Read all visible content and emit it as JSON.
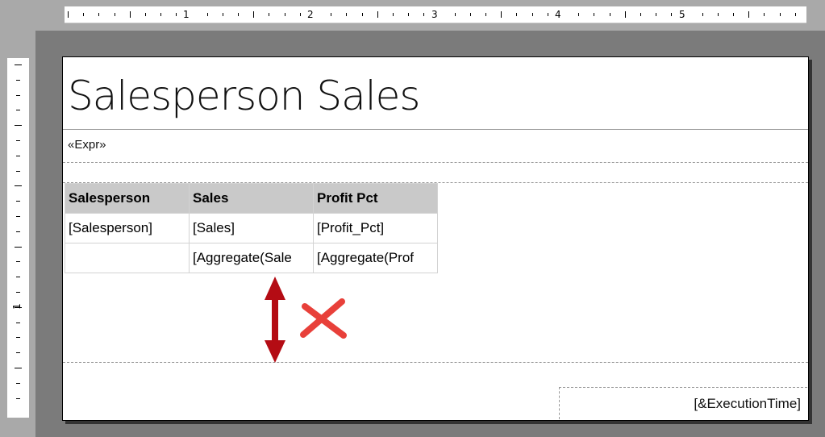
{
  "report": {
    "title": "Salesperson Sales",
    "subtitle_expr": "«Expr»",
    "table": {
      "headers": [
        "Salesperson",
        "Sales",
        "Profit Pct"
      ],
      "detail_row": [
        "[Salesperson]",
        "[Sales]",
        "[Profit_Pct]"
      ],
      "total_row": [
        "",
        "[Aggregate(Sale",
        "[Aggregate(Prof"
      ]
    },
    "footer_expr": "[&ExecutionTime]"
  },
  "ruler": {
    "horizontal_numbers": [
      "1",
      "2",
      "3",
      "4",
      "5"
    ],
    "vertical_numbers": [
      "1"
    ]
  },
  "annotation": {
    "arrow_color": "#b40c14",
    "cross_color": "#e8403a",
    "arrow_icon": "vertical-double-arrow-icon",
    "cross_icon": "red-x-icon"
  }
}
